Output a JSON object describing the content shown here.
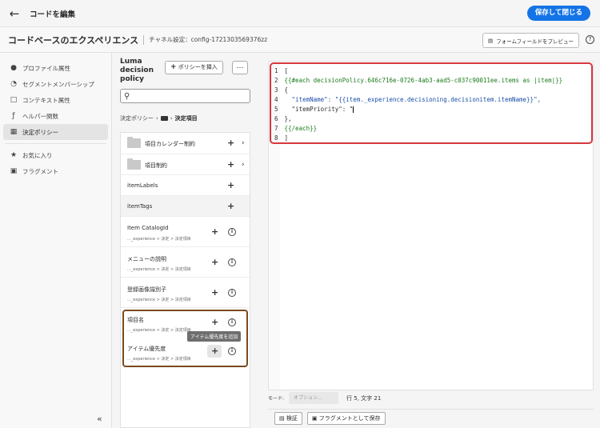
{
  "topbar": {
    "title": "コードを編集",
    "save_label": "保存して閉じる"
  },
  "header": {
    "title": "コードベースのエクスペリエンス",
    "channel": "チャネル設定：config-1721303569376zz",
    "preview_label": "フォームフィールドをプレビュー"
  },
  "sidebar": {
    "items": [
      {
        "label": "プロファイル属性",
        "icon": "person-icon"
      },
      {
        "label": "セグメントメンバーシップ",
        "icon": "segment-icon"
      },
      {
        "label": "コンテキスト属性",
        "icon": "context-icon"
      },
      {
        "label": "ヘルパー関数",
        "icon": "function-icon"
      },
      {
        "label": "決定ポリシー",
        "icon": "policy-icon"
      },
      {
        "label": "お気に入り",
        "icon": "star-icon"
      },
      {
        "label": "フラグメント",
        "icon": "fragment-icon"
      }
    ]
  },
  "panel": {
    "title": "Luma decision policy",
    "insert_label": "ポリシーを挿入",
    "more_label": "…",
    "breadcrumb_root": "決定ポリシー",
    "breadcrumb_current": "決定項目",
    "rows": [
      {
        "label": "項目カレンダー制約",
        "path": ""
      },
      {
        "label": "項目制約",
        "path": ""
      },
      {
        "label": "itemLabels",
        "path": ""
      },
      {
        "label": "itemTags",
        "path": ""
      },
      {
        "label": "Item CatalogId",
        "path": "..._experience > 決定 > 決定項目"
      },
      {
        "label": "メニューの説明",
        "path": "..._experience > 決定 > 決定項目"
      },
      {
        "label": "登録画像識別子",
        "path": "..._experience > 決定 > 決定項目"
      },
      {
        "label": "項目名",
        "path": "..._experience > 決定 > 決定項目"
      },
      {
        "label": "アイテム優先度",
        "path": "..._experience > 決定 > 決定項目"
      }
    ],
    "tooltip": "アイテム優先度を追加"
  },
  "editor": {
    "lines": [
      "[",
      "{{#each decisionPolicy.646c716e-0726-4ab3-aad5-c037c90011ee.items as |item|}}",
      "{",
      "  \"itemName\": \"{{item._experience.decisioning.decisionitem.itemName}}\",",
      "  \"itemPriority\": \"",
      "},",
      "{{/each}}",
      "]"
    ],
    "mode_label": "モード:",
    "mode_value": "オプション...",
    "position": "行 5, 文字 21",
    "validate_label": "検証",
    "save_fragment_label": "フラグメントとして保存"
  }
}
